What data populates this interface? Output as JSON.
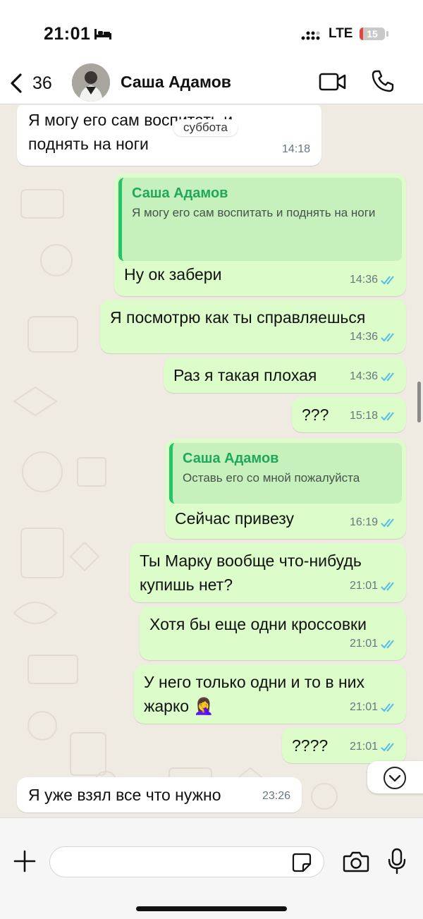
{
  "status_bar": {
    "time": "21:01",
    "network": "LTE",
    "battery_percent": "15",
    "battery_fraction": 0.15
  },
  "header": {
    "back_count": "36",
    "contact_name": "Саша Адамов"
  },
  "chat": {
    "date_chip": "суббота",
    "messages": [
      {
        "text": "Я могу его сам воспитать и поднять на ноги",
        "time": "14:18"
      },
      {
        "quote_name": "Саша Адамов",
        "quote_text": "Я могу его сам воспитать и поднять на ноги",
        "text": "Ну ок забери",
        "time": "14:36"
      },
      {
        "text": "Я посмотрю как ты справляешься",
        "time": "14:36"
      },
      {
        "text": "Раз я такая плохая",
        "time": "14:36"
      },
      {
        "text": "???",
        "time": "15:18"
      },
      {
        "quote_name": "Саша Адамов",
        "quote_text": "Оставь его со мной пожалуйста",
        "text": "Сейчас привезу",
        "time": "16:19"
      },
      {
        "text": "Ты Марку вообще что-нибудь купишь нет?",
        "time": "21:01"
      },
      {
        "text": "Хотя бы еще одни кроссовки",
        "time": "21:01"
      },
      {
        "text": "У него только одни и то в них жарко 🤦‍♀️",
        "time": "21:01"
      },
      {
        "text": "????",
        "time": "21:01"
      },
      {
        "text": "Я уже взял все что нужно",
        "time": "23:26"
      }
    ]
  },
  "input_bar": {
    "placeholder": ""
  },
  "colors": {
    "outgoing_bubble": "#d9fdd3",
    "incoming_bubble": "#ffffff",
    "quote_accent": "#25c36a",
    "read_ticks": "#53bdeb",
    "chat_background": "#efeae2"
  },
  "icons": [
    "bed-icon",
    "signal-icon",
    "back-icon",
    "video-call-icon",
    "phone-icon",
    "double-check-icon",
    "chevron-down-icon",
    "plus-icon",
    "sticker-icon",
    "camera-icon",
    "microphone-icon"
  ]
}
